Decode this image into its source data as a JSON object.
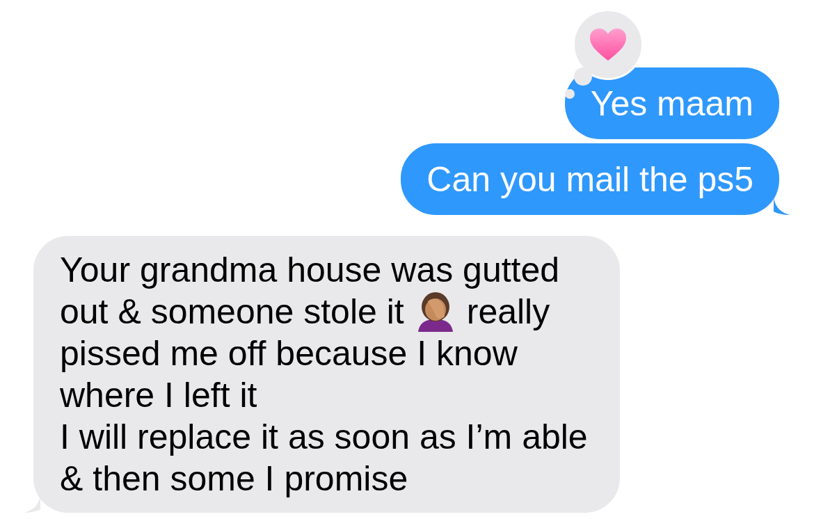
{
  "messages": [
    {
      "kind": "sent",
      "tapback": {
        "kind": "heart"
      },
      "lines": [
        [
          "Yes maam"
        ]
      ]
    },
    {
      "kind": "sent",
      "tail": true,
      "lines": [
        [
          "Can you mail the ps5"
        ]
      ]
    },
    {
      "kind": "received",
      "tail": true,
      "lines": [
        [
          "Your grandma house was gutted"
        ],
        [
          "out & someone stole it",
          {
            "kind": "emoji"
          },
          "really"
        ],
        [
          "pissed me off because I know"
        ],
        [
          "where I left it"
        ],
        [
          "I will replace it as soon as I’m able"
        ],
        [
          "& then some I promise"
        ]
      ]
    }
  ]
}
